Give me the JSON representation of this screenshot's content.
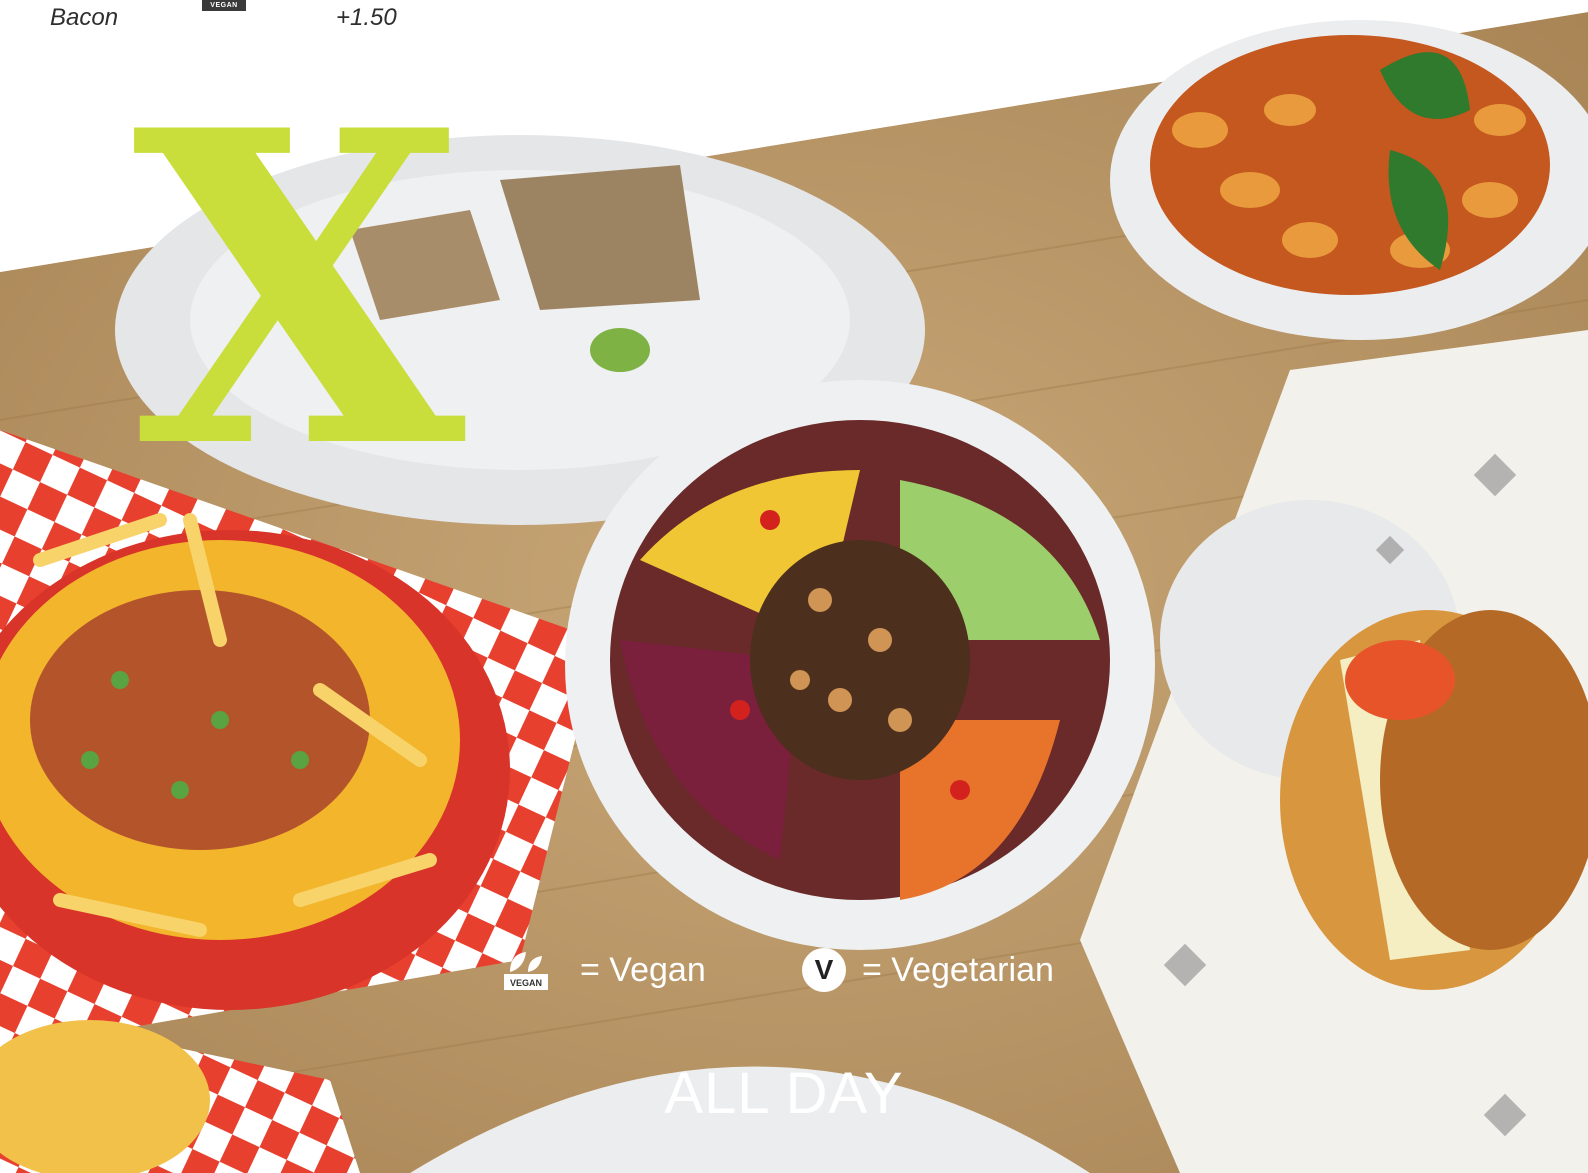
{
  "top_menu": {
    "item_name": "Bacon",
    "item_price": "+1.50",
    "badge": "VEGAN"
  },
  "logo": {
    "letter": "X",
    "color": "#c9dd3b"
  },
  "legend": {
    "vegan_badge": "VEGAN",
    "vegan_text": "= Vegan",
    "vegetarian_symbol": "V",
    "vegetarian_text": "= Vegetarian"
  },
  "section_title": "ALL DAY"
}
